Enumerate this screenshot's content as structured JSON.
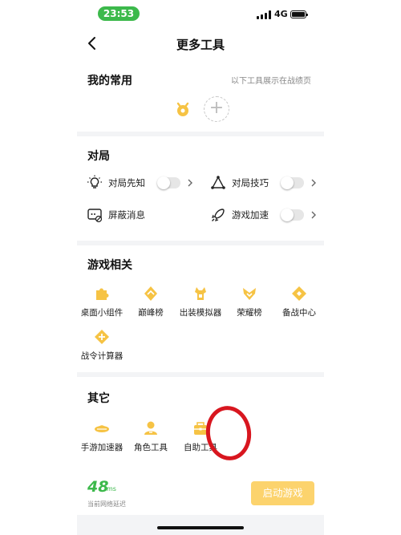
{
  "status_bar": {
    "time": "23:53",
    "network": "4G"
  },
  "nav": {
    "title": "更多工具"
  },
  "favorites": {
    "title": "我的常用",
    "note": "以下工具展示在战绩页",
    "add_label": "+"
  },
  "match": {
    "title": "对局",
    "items": [
      {
        "label": "对局先知",
        "icon": "bulb-icon",
        "on": false
      },
      {
        "label": "对局技巧",
        "icon": "triangle-nodes-icon",
        "on": false
      },
      {
        "label": "屏蔽消息",
        "icon": "message-block-icon",
        "on": false
      },
      {
        "label": "游戏加速",
        "icon": "rocket-icon",
        "on": false
      }
    ]
  },
  "game": {
    "title": "游戏相关",
    "tools": [
      {
        "label": "桌面小组件",
        "icon": "puzzle-icon"
      },
      {
        "label": "巅峰榜",
        "icon": "peak-rank-icon"
      },
      {
        "label": "出装模拟器",
        "icon": "equipment-icon"
      },
      {
        "label": "荣耀榜",
        "icon": "glory-rank-icon"
      },
      {
        "label": "备战中心",
        "icon": "battle-center-icon"
      },
      {
        "label": "战令计算器",
        "icon": "calculator-icon"
      }
    ]
  },
  "other": {
    "title": "其它",
    "tools": [
      {
        "label": "手游加速器",
        "icon": "accelerator-icon"
      },
      {
        "label": "角色工具",
        "icon": "role-icon"
      },
      {
        "label": "自助工具",
        "icon": "self-service-icon"
      }
    ]
  },
  "footer": {
    "latency_value": "48",
    "latency_unit": "ms",
    "latency_label": "当前网络延迟",
    "start_label": "启动游戏"
  },
  "colors": {
    "accent_green": "#3cb94b",
    "icon_gold": "#f6c344",
    "start_button": "#fcd36d",
    "annotation_red": "#d8161f"
  }
}
